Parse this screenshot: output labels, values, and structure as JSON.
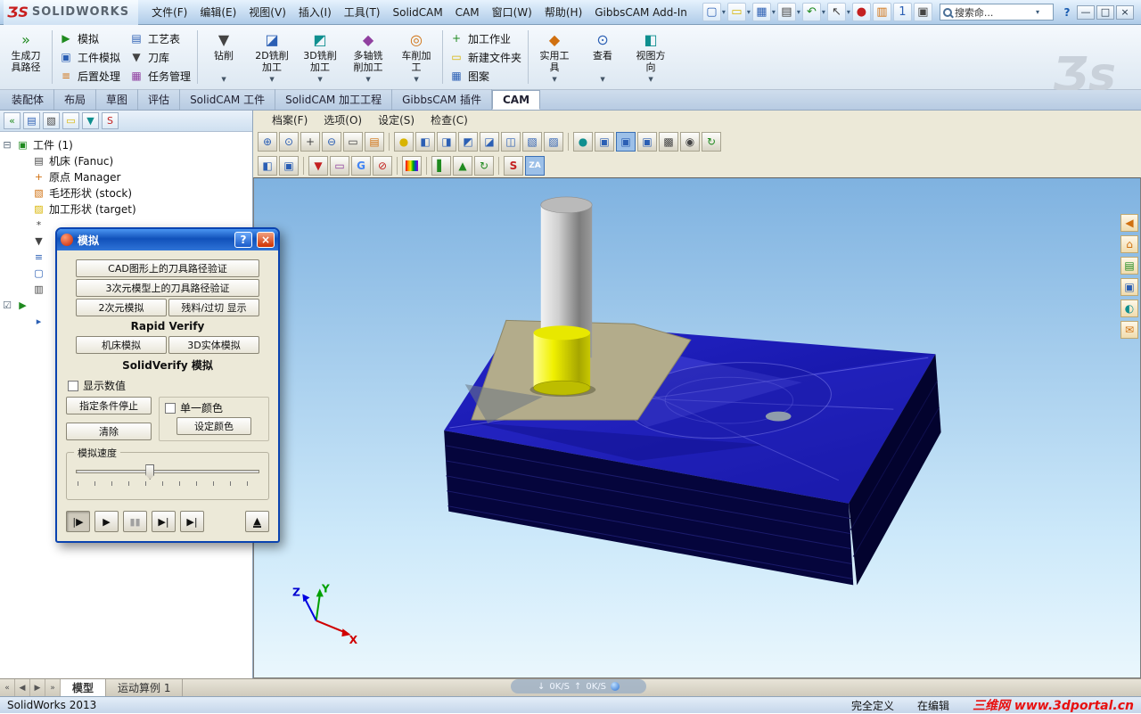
{
  "glyphs": {
    "caret": "▾",
    "dropdown": "▼"
  },
  "titlebar": {
    "logo_mark": "ƷS",
    "logo_text": "SOLIDWORKS",
    "menus": [
      "文件(F)",
      "编辑(E)",
      "视图(V)",
      "插入(I)",
      "工具(T)",
      "SolidCAM",
      "CAM",
      "窗口(W)",
      "帮助(H)",
      "GibbsCAM Add-In"
    ],
    "icons": [
      {
        "name": "new-document",
        "glyph": "▢"
      },
      {
        "name": "open",
        "glyph": "▭"
      },
      {
        "name": "save",
        "glyph": "▦"
      },
      {
        "name": "print",
        "glyph": "▤"
      },
      {
        "name": "undo",
        "glyph": "↶"
      },
      {
        "name": "select",
        "glyph": "↖"
      },
      {
        "name": "record-macro",
        "glyph": "●"
      },
      {
        "name": "options-book",
        "glyph": "▥"
      },
      {
        "name": "display-1",
        "glyph": "1"
      },
      {
        "name": "task-pane",
        "glyph": "▣"
      }
    ],
    "search_value": "搜索命...",
    "help_label": "?",
    "window_buttons": {
      "minimize": "—",
      "maximize": "□",
      "close": "×"
    }
  },
  "ribbon": {
    "generate_toolpath": {
      "glyph": "»",
      "line1": "生成刀",
      "line2": "具路径"
    },
    "sim_group": [
      {
        "glyph": "▶",
        "label": "模拟"
      },
      {
        "glyph": "▣",
        "label": "工件模拟"
      },
      {
        "glyph": "≡",
        "label": "后置处理"
      }
    ],
    "table_group": [
      {
        "glyph": "▤",
        "label": "工艺表"
      },
      {
        "glyph": "▼",
        "label": "刀库"
      },
      {
        "glyph": "▦",
        "label": "任务管理"
      }
    ],
    "mill_buttons": [
      {
        "glyph": "▼",
        "line1": "钻削",
        "line2": ""
      },
      {
        "glyph": "◪",
        "line1": "2D铣削",
        "line2": "加工"
      },
      {
        "glyph": "◩",
        "line1": "3D铣削",
        "line2": "加工"
      },
      {
        "glyph": "◆",
        "line1": "多轴铣",
        "line2": "削加工"
      },
      {
        "glyph": "◎",
        "line1": "车削加",
        "line2": "工"
      }
    ],
    "job_group": [
      {
        "glyph": "+",
        "label": "加工作业"
      },
      {
        "glyph": "▭",
        "label": "新建文件夹"
      },
      {
        "glyph": "▦",
        "label": "图案"
      }
    ],
    "view_buttons": [
      {
        "glyph": "◆",
        "line1": "实用工",
        "line2": "具"
      },
      {
        "glyph": "⊙",
        "line1": "查看",
        "line2": ""
      },
      {
        "glyph": "◧",
        "line1": "视图方",
        "line2": "向"
      }
    ],
    "watermark": "Ʒs"
  },
  "tabs": [
    "装配体",
    "布局",
    "草图",
    "评估",
    "SolidCAM 工件",
    "SolidCAM 加工工程",
    "GibbsCAM 插件",
    "CAM"
  ],
  "sidebar": {
    "toolbar": [
      {
        "name": "collapse-all",
        "glyph": "«"
      },
      {
        "name": "feature-display",
        "glyph": "▤"
      },
      {
        "name": "edit-settings",
        "glyph": "▧"
      },
      {
        "name": "folder-view",
        "glyph": "▭"
      },
      {
        "name": "filter",
        "glyph": "▼"
      },
      {
        "name": "solidcam-manager",
        "glyph": "S"
      }
    ],
    "tree": [
      {
        "exp": "⊟",
        "glyph": "▣",
        "label": "工件 (1)"
      },
      {
        "exp": "",
        "glyph": "▤",
        "label": "机床 (Fanuc)"
      },
      {
        "exp": "",
        "glyph": "+",
        "label": "原点 Manager"
      },
      {
        "exp": "",
        "glyph": "▧",
        "label": "毛坯形状 (stock)"
      },
      {
        "exp": "",
        "glyph": "▨",
        "label": "加工形状 (target)"
      },
      {
        "exp": "",
        "glyph": "*",
        "label": ""
      },
      {
        "exp": "",
        "glyph": "▼",
        "label": ""
      },
      {
        "exp": "",
        "glyph": "≡",
        "label": ""
      },
      {
        "exp": "",
        "glyph": "▢",
        "label": ""
      },
      {
        "exp": "",
        "glyph": "▥",
        "label": ""
      },
      {
        "exp": "☑",
        "glyph": "▶",
        "label": ""
      },
      {
        "exp": "",
        "glyph": "▸",
        "label": ""
      }
    ],
    "doc_nav": [
      "«",
      "◀",
      "▶",
      "»"
    ],
    "doc_tabs": [
      "模型",
      "运动算例 1"
    ]
  },
  "cam": {
    "menus": [
      "档案(F)",
      "选项(O)",
      "设定(S)",
      "检查(C)"
    ],
    "toolbar_main": [
      {
        "name": "zoom-window",
        "glyph": "⊕"
      },
      {
        "name": "zoom-dynamic",
        "glyph": "⊙"
      },
      {
        "name": "pan",
        "glyph": "+"
      },
      {
        "name": "zoom-fit",
        "glyph": "⊖"
      },
      {
        "name": "measure",
        "glyph": "▭"
      },
      {
        "name": "sheet",
        "glyph": "▤"
      },
      {
        "name": "light",
        "glyph": "●"
      },
      {
        "name": "view-back",
        "glyph": "◧"
      },
      {
        "name": "view-front",
        "glyph": "◨"
      },
      {
        "name": "view-left",
        "glyph": "◩"
      },
      {
        "name": "view-right",
        "glyph": "◪"
      },
      {
        "name": "view-top",
        "glyph": "◫"
      },
      {
        "name": "view-bottom",
        "glyph": "▧"
      },
      {
        "name": "view-iso",
        "glyph": "▨"
      },
      {
        "name": "shaded",
        "glyph": "●"
      },
      {
        "name": "iso-1",
        "glyph": "▣"
      },
      {
        "name": "iso-2",
        "glyph": "▣"
      },
      {
        "name": "iso-3",
        "glyph": "▣"
      },
      {
        "name": "wireframe",
        "glyph": "▩"
      },
      {
        "name": "camera",
        "glyph": "◉"
      },
      {
        "name": "redraw",
        "glyph": "↻"
      }
    ],
    "toolbar_secondary": [
      {
        "name": "face-mode",
        "glyph": "◧"
      },
      {
        "name": "solid-mode",
        "glyph": "▣"
      },
      {
        "name": "tool-display",
        "glyph": "▼"
      },
      {
        "name": "erase",
        "glyph": "▭"
      },
      {
        "name": "gibbs-g",
        "glyph": "G"
      },
      {
        "name": "stop-check",
        "glyph": "⊘"
      },
      {
        "name": "color-bars",
        "glyph": ""
      },
      {
        "name": "marker-green",
        "glyph": "▌"
      },
      {
        "name": "verify-green",
        "glyph": "▲"
      },
      {
        "name": "recycle",
        "glyph": "↻"
      },
      {
        "name": "solidcam-swirl",
        "glyph": "S"
      },
      {
        "name": "za-tool",
        "glyph": "ZA"
      }
    ],
    "right_toolbar": [
      {
        "name": "flyout",
        "glyph": "◀"
      },
      {
        "name": "home",
        "glyph": "⌂"
      },
      {
        "name": "library",
        "glyph": "▤"
      },
      {
        "name": "parts",
        "glyph": "▣"
      },
      {
        "name": "globe",
        "glyph": "◐"
      },
      {
        "name": "export",
        "glyph": "✉"
      }
    ],
    "triad": {
      "x": "X",
      "y": "Y",
      "z": "Z"
    },
    "network": {
      "down_arrow": "↓",
      "down": "0K/S",
      "up_arrow": "↑",
      "up": "0K/S"
    }
  },
  "dialog": {
    "title": "模拟",
    "help_label": "?",
    "close_label": "×",
    "btn_cad_verify": "CAD图形上的刀具路径验证",
    "btn_3d_verify": "3次元模型上的刀具路径验证",
    "btn_2d_sim": "2次元模拟",
    "btn_rest": "残料/过切 显示",
    "hdr_rapid": "Rapid Verify",
    "btn_machine_sim": "机床模拟",
    "btn_solid3d": "3D实体模拟",
    "hdr_solidverify": "SolidVerify 模拟",
    "chk_show_values": "显示数值",
    "btn_stop_condition": "指定条件停止",
    "chk_single_color": "单一颜色",
    "btn_clear": "清除",
    "btn_set_color": "设定颜色",
    "speed_label": "模拟速度",
    "transport": [
      {
        "name": "play-step",
        "glyph": "|▶"
      },
      {
        "name": "play",
        "glyph": "▶"
      },
      {
        "name": "pause",
        "glyph": "▮▮"
      },
      {
        "name": "play-to-break",
        "glyph": "▶|"
      },
      {
        "name": "play-to-end",
        "glyph": "▶|"
      },
      {
        "name": "eject",
        "glyph": "▲"
      }
    ]
  },
  "status": {
    "app": "SolidWorks 2013",
    "fully_defined": "完全定义",
    "editing": "在编辑",
    "watermark": "三维网 www.3dportal.cn"
  }
}
